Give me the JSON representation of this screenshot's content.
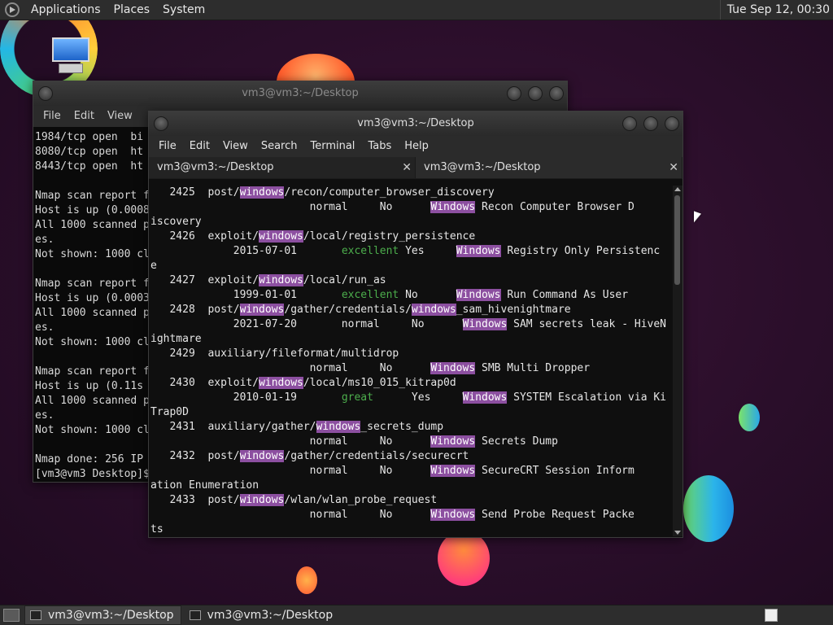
{
  "top_panel": {
    "menu": [
      "Applications",
      "Places",
      "System"
    ],
    "clock": "Tue Sep 12, 00:30"
  },
  "back_window": {
    "title": "vm3@vm3:~/Desktop",
    "menu": [
      "File",
      "Edit",
      "View"
    ],
    "lines": [
      "1984/tcp open  bi",
      "8080/tcp open  ht",
      "8443/tcp open  ht",
      "",
      "Nmap scan report f",
      "Host is up (0.0008",
      "All 1000 scanned p",
      "es.",
      "Not shown: 1000 cl",
      "",
      "Nmap scan report f",
      "Host is up (0.0003",
      "All 1000 scanned p",
      "es.",
      "Not shown: 1000 cl",
      "",
      "Nmap scan report f",
      "Host is up (0.11s",
      "All 1000 scanned p",
      "es.",
      "Not shown: 1000 cl",
      "",
      "Nmap done: 256 IP",
      "[vm3@vm3 Desktop]$"
    ]
  },
  "front_window": {
    "title": "vm3@vm3:~/Desktop",
    "menu": [
      "File",
      "Edit",
      "View",
      "Search",
      "Terminal",
      "Tabs",
      "Help"
    ],
    "tabs": [
      "vm3@vm3:~/Desktop",
      "vm3@vm3:~/Desktop"
    ],
    "highlight_term": "windows",
    "highlight_term_cap": "Windows",
    "lines": [
      [
        [
          "   2425  post/",
          ""
        ],
        [
          "windows",
          "hl"
        ],
        [
          "/recon/computer_browser_discovery",
          ""
        ]
      ],
      [
        [
          "                         normal     No      ",
          ""
        ],
        [
          "Windows",
          "hl"
        ],
        [
          " Recon Computer Browser D",
          ""
        ]
      ],
      [
        [
          "iscovery",
          ""
        ]
      ],
      [
        [
          "   2426  exploit/",
          ""
        ],
        [
          "windows",
          "hl"
        ],
        [
          "/local/registry_persistence",
          ""
        ]
      ],
      [
        [
          "             2015-07-01       ",
          ""
        ],
        [
          "excellent",
          "gr"
        ],
        [
          " Yes     ",
          ""
        ],
        [
          "Windows",
          "hl"
        ],
        [
          " Registry Only Persistenc",
          ""
        ]
      ],
      [
        [
          "e",
          ""
        ]
      ],
      [
        [
          "   2427  exploit/",
          ""
        ],
        [
          "windows",
          "hl"
        ],
        [
          "/local/run_as",
          ""
        ]
      ],
      [
        [
          "             1999-01-01       ",
          ""
        ],
        [
          "excellent",
          "gr"
        ],
        [
          " No      ",
          ""
        ],
        [
          "Windows",
          "hl"
        ],
        [
          " Run Command As User",
          ""
        ]
      ],
      [
        [
          "   2428  post/",
          ""
        ],
        [
          "windows",
          "hl"
        ],
        [
          "/gather/credentials/",
          ""
        ],
        [
          "windows",
          "hl"
        ],
        [
          "_sam_hivenightmare",
          ""
        ]
      ],
      [
        [
          "             2021-07-20       normal     No      ",
          ""
        ],
        [
          "Windows",
          "hl"
        ],
        [
          " SAM secrets leak - HiveN",
          ""
        ]
      ],
      [
        [
          "ightmare",
          ""
        ]
      ],
      [
        [
          "   2429  auxiliary/fileformat/multidrop",
          ""
        ]
      ],
      [
        [
          "                         normal     No      ",
          ""
        ],
        [
          "Windows",
          "hl"
        ],
        [
          " SMB Multi Dropper",
          ""
        ]
      ],
      [
        [
          "   2430  exploit/",
          ""
        ],
        [
          "windows",
          "hl"
        ],
        [
          "/local/ms10_015_kitrap0d",
          ""
        ]
      ],
      [
        [
          "             2010-01-19       ",
          ""
        ],
        [
          "great",
          "gr"
        ],
        [
          "      Yes     ",
          ""
        ],
        [
          "Windows",
          "hl"
        ],
        [
          " SYSTEM Escalation via Ki",
          ""
        ]
      ],
      [
        [
          "Trap0D",
          ""
        ]
      ],
      [
        [
          "   2431  auxiliary/gather/",
          ""
        ],
        [
          "windows",
          "hl"
        ],
        [
          "_secrets_dump",
          ""
        ]
      ],
      [
        [
          "                         normal     No      ",
          ""
        ],
        [
          "Windows",
          "hl"
        ],
        [
          " Secrets Dump",
          ""
        ]
      ],
      [
        [
          "   2432  post/",
          ""
        ],
        [
          "windows",
          "hl"
        ],
        [
          "/gather/credentials/securecrt",
          ""
        ]
      ],
      [
        [
          "                         normal     No      ",
          ""
        ],
        [
          "Windows",
          "hl"
        ],
        [
          " SecureCRT Session Inform",
          ""
        ]
      ],
      [
        [
          "ation Enumeration",
          ""
        ]
      ],
      [
        [
          "   2433  post/",
          ""
        ],
        [
          "windows",
          "hl"
        ],
        [
          "/wlan/wlan_probe_request",
          ""
        ]
      ],
      [
        [
          "                         normal     No      ",
          ""
        ],
        [
          "Windows",
          "hl"
        ],
        [
          " Send Probe Request Packe",
          ""
        ]
      ],
      [
        [
          "ts",
          ""
        ]
      ]
    ]
  },
  "taskbar": {
    "tasks": [
      "vm3@vm3:~/Desktop",
      "vm3@vm3:~/Desktop"
    ]
  },
  "colors": {
    "highlight": "#8c4fa0",
    "rank_green": "#4cae4c",
    "desktop_bg": "#2a0e2a"
  }
}
